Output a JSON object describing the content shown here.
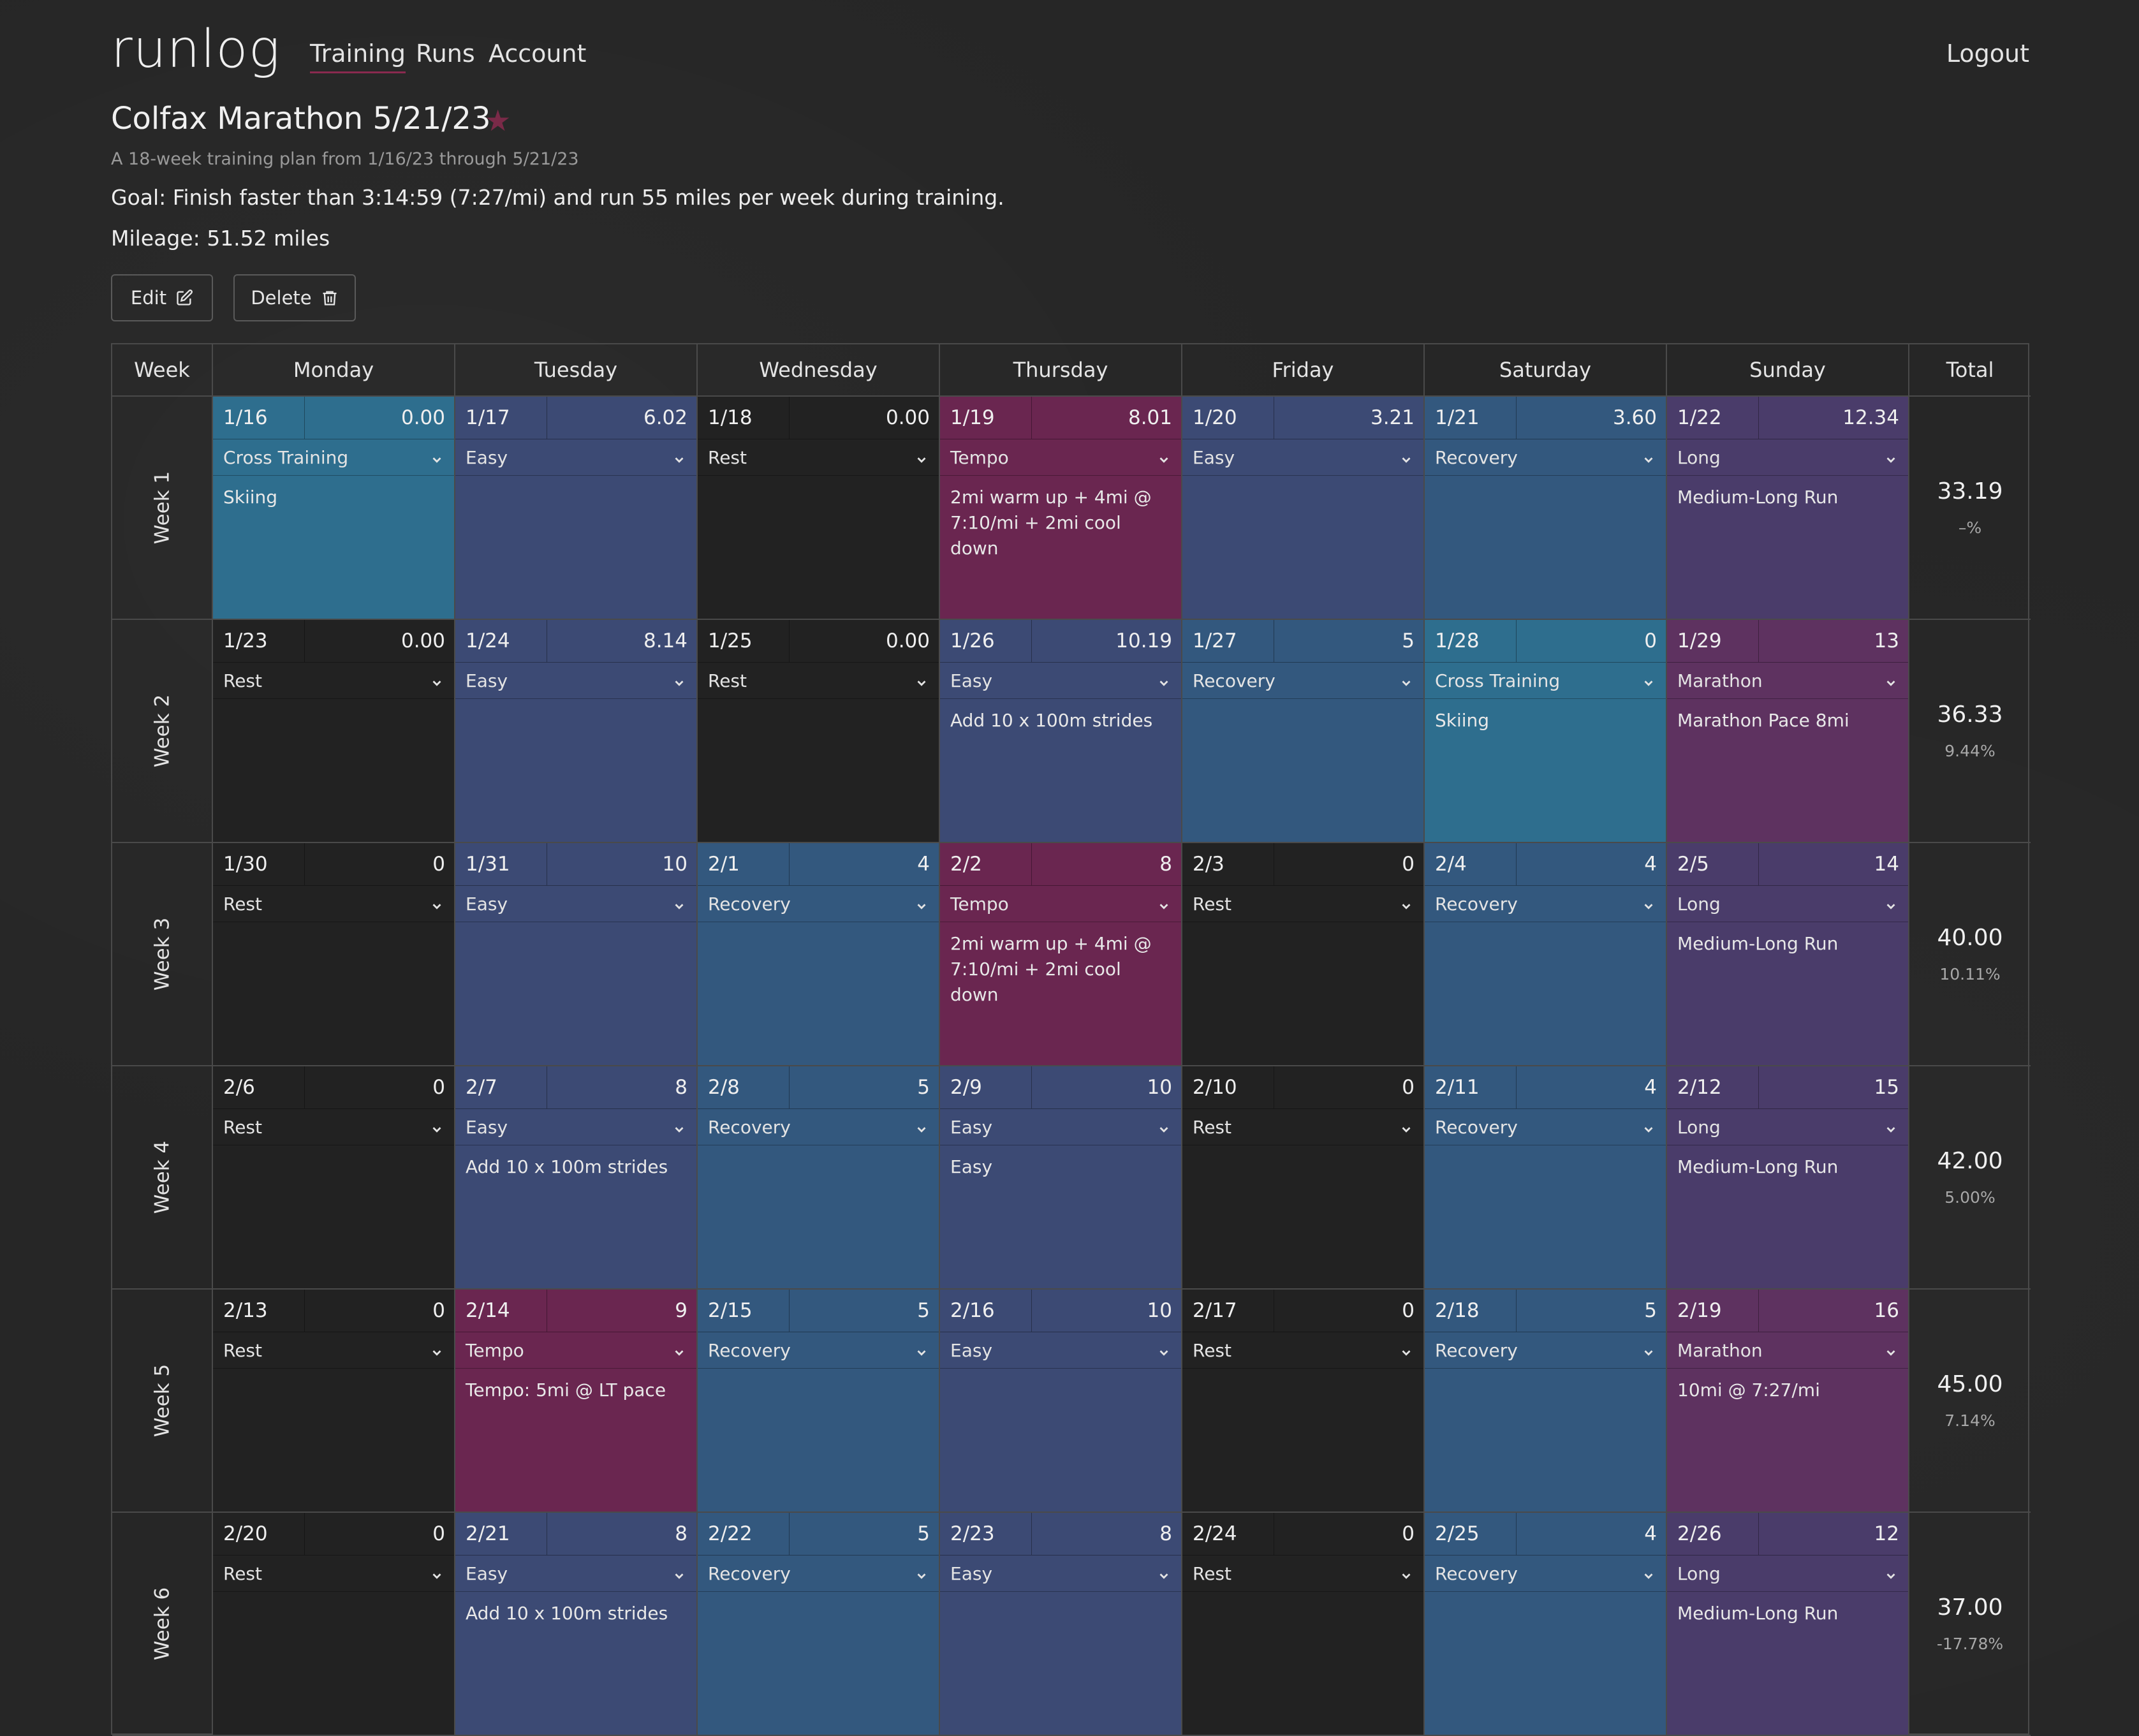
{
  "app": {
    "logo": "runlog"
  },
  "nav": {
    "items": [
      "Training",
      "Runs",
      "Account"
    ],
    "logout": "Logout"
  },
  "plan": {
    "title": "Colfax Marathon 5/21/23",
    "subtitle": "A 18-week training plan from 1/16/23 through 5/21/23",
    "goal": "Goal: Finish faster than 3:14:59 (7:27/mi) and run 55 miles per week during training.",
    "mileage": "Mileage: 51.52 miles"
  },
  "actions": {
    "edit_label": "Edit",
    "delete_label": "Delete"
  },
  "colors": {
    "cross_training": "#2e6e8e",
    "easy": "#3c4a74",
    "rest": "#222222",
    "tempo": "#6a2650",
    "recovery": "#33587e",
    "long": "#4a3c6a",
    "marathon": "#5e3260",
    "accent": "#8a2a4f"
  },
  "table": {
    "headers": [
      "Week",
      "Monday",
      "Tuesday",
      "Wednesday",
      "Thursday",
      "Friday",
      "Saturday",
      "Sunday",
      "Total"
    ],
    "weeks": [
      {
        "label": "Week 1",
        "total": "33.19",
        "pct": "–%",
        "days": [
          {
            "date": "1/16",
            "miles": "0.00",
            "type": "Cross Training",
            "note": "Skiing"
          },
          {
            "date": "1/17",
            "miles": "6.02",
            "type": "Easy",
            "note": ""
          },
          {
            "date": "1/18",
            "miles": "0.00",
            "type": "Rest",
            "note": ""
          },
          {
            "date": "1/19",
            "miles": "8.01",
            "type": "Tempo",
            "note": "2mi warm up + 4mi @ 7:10/mi + 2mi cool down"
          },
          {
            "date": "1/20",
            "miles": "3.21",
            "type": "Easy",
            "note": ""
          },
          {
            "date": "1/21",
            "miles": "3.60",
            "type": "Recovery",
            "note": ""
          },
          {
            "date": "1/22",
            "miles": "12.34",
            "type": "Long",
            "note": "Medium-Long Run"
          }
        ]
      },
      {
        "label": "Week 2",
        "total": "36.33",
        "pct": "9.44%",
        "days": [
          {
            "date": "1/23",
            "miles": "0.00",
            "type": "Rest",
            "note": ""
          },
          {
            "date": "1/24",
            "miles": "8.14",
            "type": "Easy",
            "note": ""
          },
          {
            "date": "1/25",
            "miles": "0.00",
            "type": "Rest",
            "note": ""
          },
          {
            "date": "1/26",
            "miles": "10.19",
            "type": "Easy",
            "note": "Add 10 x 100m strides"
          },
          {
            "date": "1/27",
            "miles": "5",
            "type": "Recovery",
            "note": ""
          },
          {
            "date": "1/28",
            "miles": "0",
            "type": "Cross Training",
            "note": "Skiing"
          },
          {
            "date": "1/29",
            "miles": "13",
            "type": "Marathon",
            "note": "Marathon Pace 8mi"
          }
        ]
      },
      {
        "label": "Week 3",
        "total": "40.00",
        "pct": "10.11%",
        "days": [
          {
            "date": "1/30",
            "miles": "0",
            "type": "Rest",
            "note": ""
          },
          {
            "date": "1/31",
            "miles": "10",
            "type": "Easy",
            "note": ""
          },
          {
            "date": "2/1",
            "miles": "4",
            "type": "Recovery",
            "note": ""
          },
          {
            "date": "2/2",
            "miles": "8",
            "type": "Tempo",
            "note": "2mi warm up + 4mi @ 7:10/mi + 2mi cool down"
          },
          {
            "date": "2/3",
            "miles": "0",
            "type": "Rest",
            "note": ""
          },
          {
            "date": "2/4",
            "miles": "4",
            "type": "Recovery",
            "note": ""
          },
          {
            "date": "2/5",
            "miles": "14",
            "type": "Long",
            "note": "Medium-Long Run"
          }
        ]
      },
      {
        "label": "Week 4",
        "total": "42.00",
        "pct": "5.00%",
        "days": [
          {
            "date": "2/6",
            "miles": "0",
            "type": "Rest",
            "note": ""
          },
          {
            "date": "2/7",
            "miles": "8",
            "type": "Easy",
            "note": "Add 10 x 100m strides"
          },
          {
            "date": "2/8",
            "miles": "5",
            "type": "Recovery",
            "note": ""
          },
          {
            "date": "2/9",
            "miles": "10",
            "type": "Easy",
            "note": "Easy"
          },
          {
            "date": "2/10",
            "miles": "0",
            "type": "Rest",
            "note": ""
          },
          {
            "date": "2/11",
            "miles": "4",
            "type": "Recovery",
            "note": ""
          },
          {
            "date": "2/12",
            "miles": "15",
            "type": "Long",
            "note": "Medium-Long Run"
          }
        ]
      },
      {
        "label": "Week 5",
        "total": "45.00",
        "pct": "7.14%",
        "days": [
          {
            "date": "2/13",
            "miles": "0",
            "type": "Rest",
            "note": ""
          },
          {
            "date": "2/14",
            "miles": "9",
            "type": "Tempo",
            "note": "Tempo: 5mi @ LT pace"
          },
          {
            "date": "2/15",
            "miles": "5",
            "type": "Recovery",
            "note": ""
          },
          {
            "date": "2/16",
            "miles": "10",
            "type": "Easy",
            "note": ""
          },
          {
            "date": "2/17",
            "miles": "0",
            "type": "Rest",
            "note": ""
          },
          {
            "date": "2/18",
            "miles": "5",
            "type": "Recovery",
            "note": ""
          },
          {
            "date": "2/19",
            "miles": "16",
            "type": "Marathon",
            "note": "10mi @ 7:27/mi"
          }
        ]
      },
      {
        "label": "Week 6",
        "total": "37.00",
        "pct": "-17.78%",
        "days": [
          {
            "date": "2/20",
            "miles": "0",
            "type": "Rest",
            "note": ""
          },
          {
            "date": "2/21",
            "miles": "8",
            "type": "Easy",
            "note": "Add 10 x 100m strides"
          },
          {
            "date": "2/22",
            "miles": "5",
            "type": "Recovery",
            "note": ""
          },
          {
            "date": "2/23",
            "miles": "8",
            "type": "Easy",
            "note": ""
          },
          {
            "date": "2/24",
            "miles": "0",
            "type": "Rest",
            "note": ""
          },
          {
            "date": "2/25",
            "miles": "4",
            "type": "Recovery",
            "note": ""
          },
          {
            "date": "2/26",
            "miles": "12",
            "type": "Long",
            "note": "Medium-Long Run"
          }
        ]
      }
    ]
  }
}
